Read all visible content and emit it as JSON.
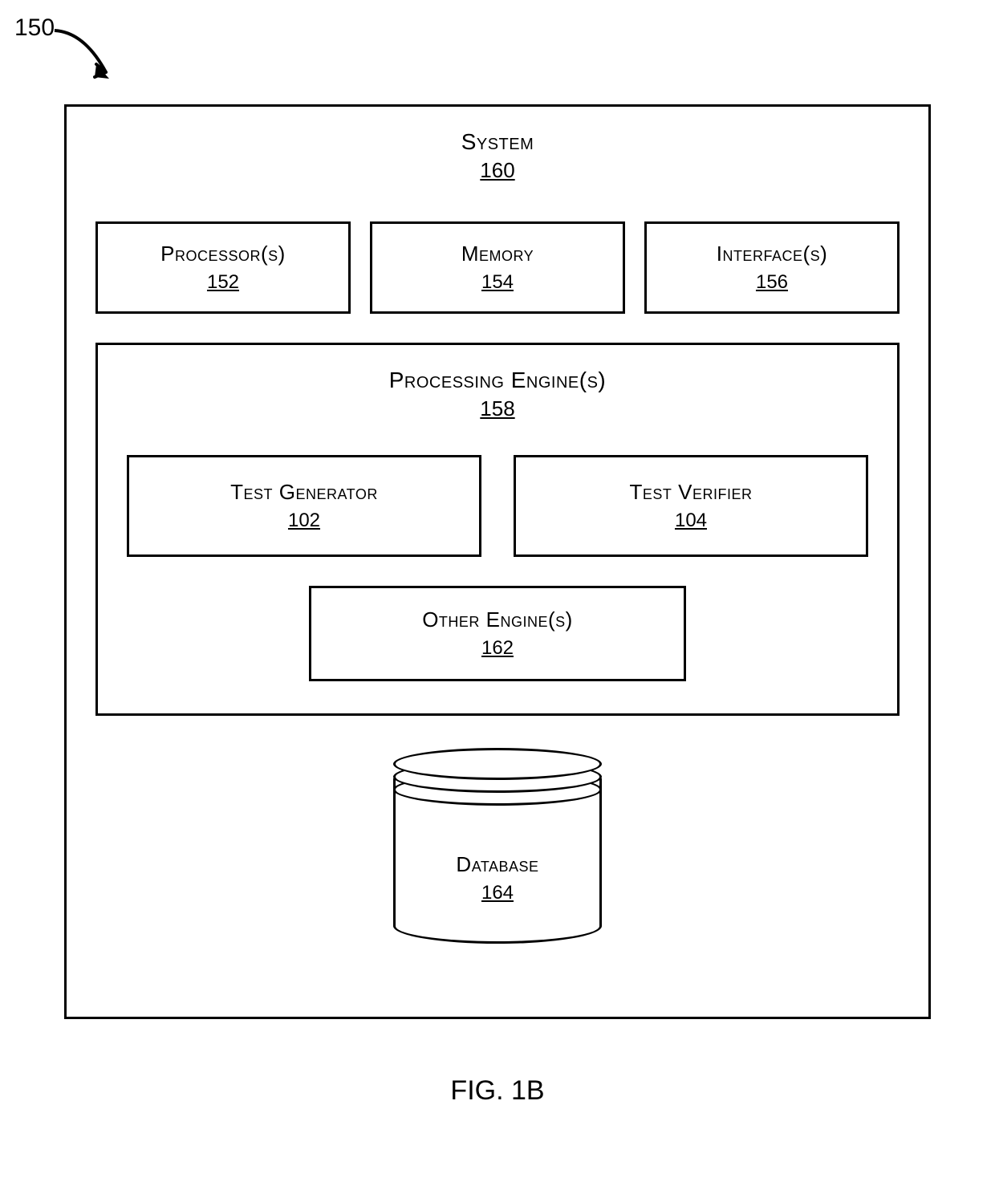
{
  "figure_ref": "150",
  "figure_caption": "FIG. 1B",
  "system": {
    "label": "System",
    "num": "160"
  },
  "top_row": [
    {
      "label": "Processor(s)",
      "num": "152"
    },
    {
      "label": "Memory",
      "num": "154"
    },
    {
      "label": "Interface(s)",
      "num": "156"
    }
  ],
  "engines": {
    "title": {
      "label": "Processing Engine(s)",
      "num": "158"
    },
    "row": [
      {
        "label": "Test Generator",
        "num": "102"
      },
      {
        "label": "Test Verifier",
        "num": "104"
      }
    ],
    "other": {
      "label": "Other Engine(s)",
      "num": "162"
    }
  },
  "database": {
    "label": "Database",
    "num": "164"
  }
}
